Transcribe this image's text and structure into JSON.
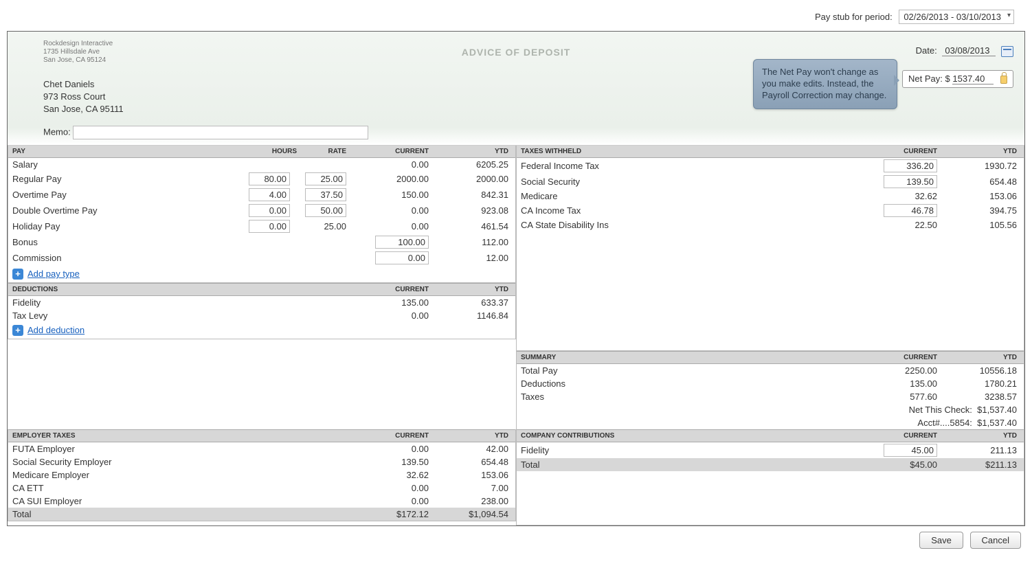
{
  "top": {
    "period_label": "Pay stub for period:",
    "period_value": "02/26/2013 - 03/10/2013"
  },
  "header": {
    "company_line1": "Rockdesign Interactive",
    "company_line2": "1735 Hillsdale Ave",
    "company_line3": "San Jose, CA 95124",
    "advice_title": "ADVICE OF DEPOSIT",
    "date_label": "Date:",
    "date_value": "03/08/2013",
    "netpay_label": "Net Pay: $",
    "netpay_value": "1537.40",
    "tooltip": "The Net Pay won't change as you make edits. Instead, the Payroll Correction may change.",
    "employee_line1": "Chet Daniels",
    "employee_line2": "973 Ross Court",
    "employee_line3": "San Jose, CA 95111",
    "memo_label": "Memo:"
  },
  "col_headers": {
    "hours": "Hours",
    "rate": "Rate",
    "current": "Current",
    "ytd": "YTD"
  },
  "pay": {
    "title": "PAY",
    "rows": [
      {
        "label": "Salary",
        "hours": "",
        "rate": "",
        "current": "0.00",
        "ytd": "6205.25",
        "h_edit": false,
        "r_edit": false,
        "c_edit": false
      },
      {
        "label": "Regular Pay",
        "hours": "80.00",
        "rate": "25.00",
        "current": "2000.00",
        "ytd": "2000.00",
        "h_edit": true,
        "r_edit": true,
        "c_edit": false
      },
      {
        "label": "Overtime Pay",
        "hours": "4.00",
        "rate": "37.50",
        "current": "150.00",
        "ytd": "842.31",
        "h_edit": true,
        "r_edit": true,
        "c_edit": false
      },
      {
        "label": "Double Overtime Pay",
        "hours": "0.00",
        "rate": "50.00",
        "current": "0.00",
        "ytd": "923.08",
        "h_edit": true,
        "r_edit": true,
        "c_edit": false
      },
      {
        "label": "Holiday Pay",
        "hours": "0.00",
        "rate": "25.00",
        "current": "0.00",
        "ytd": "461.54",
        "h_edit": true,
        "r_edit": false,
        "c_edit": false
      },
      {
        "label": "Bonus",
        "hours": "",
        "rate": "",
        "current": "100.00",
        "ytd": "112.00",
        "h_edit": false,
        "r_edit": false,
        "c_edit": true
      },
      {
        "label": "Commission",
        "hours": "",
        "rate": "",
        "current": "0.00",
        "ytd": "12.00",
        "h_edit": false,
        "r_edit": false,
        "c_edit": true
      }
    ],
    "add_label": "Add pay type"
  },
  "deductions": {
    "title": "DEDUCTIONS",
    "rows": [
      {
        "label": "Fidelity",
        "current": "135.00",
        "ytd": "633.37"
      },
      {
        "label": "Tax Levy",
        "current": "0.00",
        "ytd": "1146.84"
      }
    ],
    "add_label": "Add deduction"
  },
  "taxes_withheld": {
    "title": "TAXES WITHHELD",
    "rows": [
      {
        "label": "Federal Income Tax",
        "current": "336.20",
        "ytd": "1930.72",
        "edit": true
      },
      {
        "label": "Social Security",
        "current": "139.50",
        "ytd": "654.48",
        "edit": true
      },
      {
        "label": "Medicare",
        "current": "32.62",
        "ytd": "153.06",
        "edit": false
      },
      {
        "label": "CA Income Tax",
        "current": "46.78",
        "ytd": "394.75",
        "edit": true
      },
      {
        "label": "CA State Disability Ins",
        "current": "22.50",
        "ytd": "105.56",
        "edit": false
      }
    ]
  },
  "summary": {
    "title": "SUMMARY",
    "rows": [
      {
        "label": "Total Pay",
        "current": "2250.00",
        "ytd": "10556.18"
      },
      {
        "label": "Deductions",
        "current": "135.00",
        "ytd": "1780.21"
      },
      {
        "label": "Taxes",
        "current": "577.60",
        "ytd": "3238.57"
      }
    ],
    "footer1_label": "Net This Check:",
    "footer1_value": "$1,537.40",
    "footer2_label": "Acct#....5854:",
    "footer2_value": "$1,537.40"
  },
  "employer_taxes": {
    "title": "EMPLOYER TAXES",
    "rows": [
      {
        "label": "FUTA Employer",
        "current": "0.00",
        "ytd": "42.00"
      },
      {
        "label": "Social Security Employer",
        "current": "139.50",
        "ytd": "654.48"
      },
      {
        "label": "Medicare Employer",
        "current": "32.62",
        "ytd": "153.06"
      },
      {
        "label": "CA ETT",
        "current": "0.00",
        "ytd": "7.00"
      },
      {
        "label": "CA SUI Employer",
        "current": "0.00",
        "ytd": "238.00"
      }
    ],
    "total_label": "Total",
    "total_current": "$172.12",
    "total_ytd": "$1,094.54"
  },
  "company_contrib": {
    "title": "COMPANY CONTRIBUTIONS",
    "rows": [
      {
        "label": "Fidelity",
        "current": "45.00",
        "ytd": "211.13",
        "edit": true
      }
    ],
    "total_label": "Total",
    "total_current": "$45.00",
    "total_ytd": "$211.13"
  },
  "buttons": {
    "save": "Save",
    "cancel": "Cancel"
  }
}
